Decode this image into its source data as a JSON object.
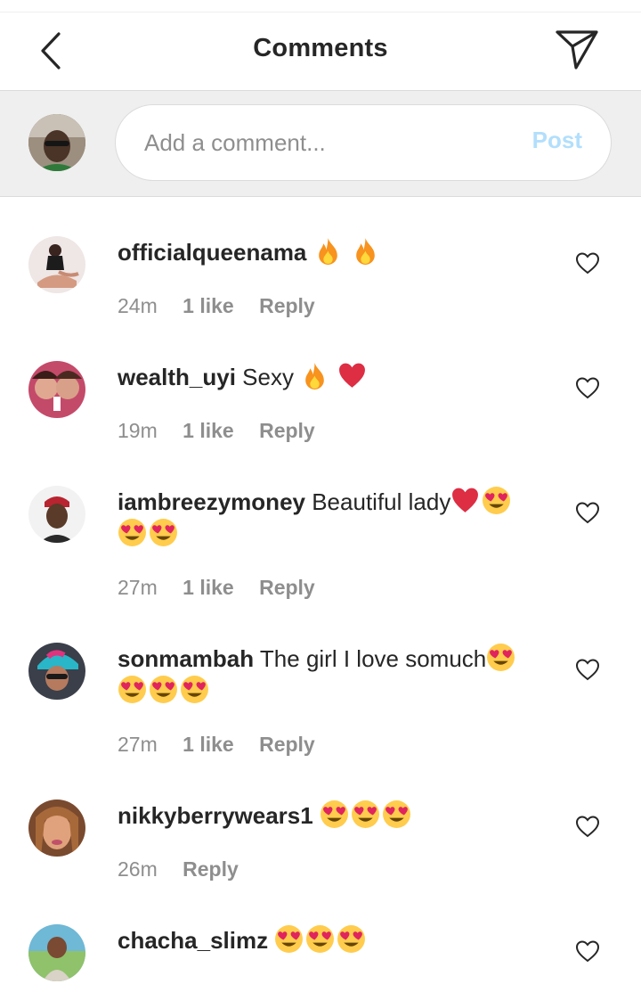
{
  "header": {
    "title": "Comments",
    "back_icon": "chevron-left-icon",
    "share_icon": "paper-plane-icon"
  },
  "composer": {
    "placeholder": "Add a comment...",
    "post_label": "Post",
    "post_color": "#b2dffc"
  },
  "comments": [
    {
      "username": "officialqueenama",
      "text": "",
      "emojis": [
        "fire",
        "fire"
      ],
      "emojis_line2": [],
      "time": "24m",
      "likes": "1 like",
      "reply": "Reply"
    },
    {
      "username": "wealth_uyi",
      "text": "Sexy",
      "emojis": [
        "fire",
        "red-heart"
      ],
      "emojis_line2": [],
      "time": "19m",
      "likes": "1 like",
      "reply": "Reply"
    },
    {
      "username": "iambreezymoney",
      "text": "Beautiful lady",
      "emojis": [
        "red-heart",
        "heart-eyes"
      ],
      "emojis_line2": [
        "heart-eyes",
        "heart-eyes"
      ],
      "time": "27m",
      "likes": "1 like",
      "reply": "Reply"
    },
    {
      "username": "sonmambah",
      "text": "The girl I love somuch",
      "emojis": [
        "heart-eyes"
      ],
      "emojis_line2": [
        "heart-eyes",
        "heart-eyes",
        "heart-eyes"
      ],
      "time": "27m",
      "likes": "1 like",
      "reply": "Reply"
    },
    {
      "username": "nikkyberrywears1",
      "text": "",
      "emojis": [
        "heart-eyes",
        "heart-eyes",
        "heart-eyes"
      ],
      "emojis_line2": [],
      "time": "26m",
      "likes": "",
      "reply": "Reply"
    },
    {
      "username": "chacha_slimz",
      "text": "",
      "emojis": [
        "heart-eyes",
        "heart-eyes",
        "heart-eyes"
      ],
      "emojis_line2": [],
      "time": "",
      "likes": "",
      "reply": ""
    }
  ],
  "colors": {
    "primary_text": "#262626",
    "secondary_text": "#8e8e8e",
    "composer_bg": "#efefef"
  }
}
